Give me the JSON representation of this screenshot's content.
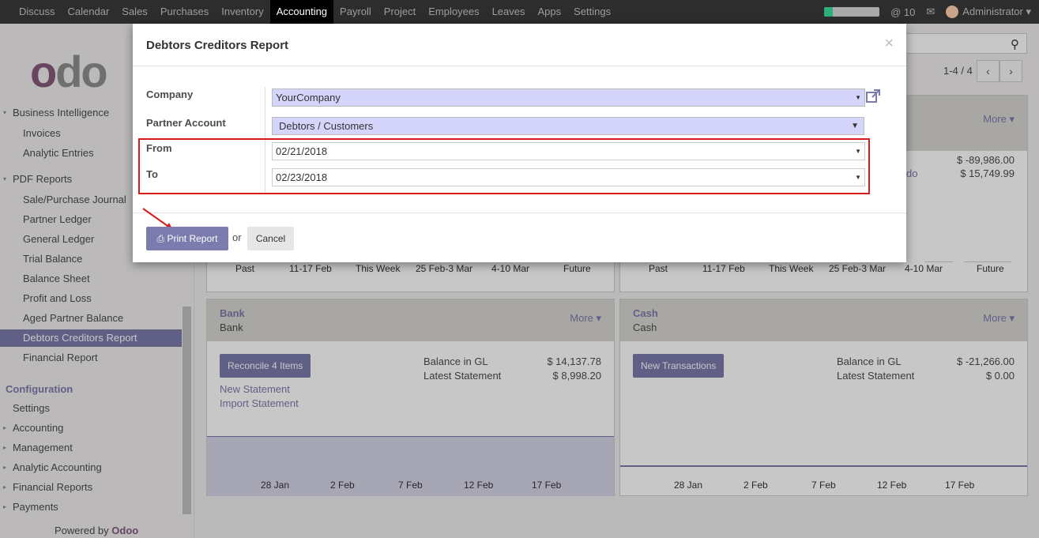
{
  "topbar": {
    "menu": [
      "Discuss",
      "Calendar",
      "Sales",
      "Purchases",
      "Inventory",
      "Accounting",
      "Payroll",
      "Project",
      "Employees",
      "Leaves",
      "Apps",
      "Settings"
    ],
    "active": "Accounting",
    "mentions": "@ 10",
    "user": "Administrator"
  },
  "sidebar": {
    "business_intelligence": "Business Intelligence",
    "invoices": "Invoices",
    "analytic_entries": "Analytic Entries",
    "pdf_reports": "PDF Reports",
    "reports": [
      "Sale/Purchase Journal",
      "Partner Ledger",
      "General Ledger",
      "Trial Balance",
      "Balance Sheet",
      "Profit and Loss",
      "Aged Partner Balance",
      "Debtors Creditors Report",
      "Financial Report"
    ],
    "configuration": "Configuration",
    "config_items": [
      "Settings",
      "Accounting",
      "Management",
      "Analytic Accounting",
      "Financial Reports",
      "Payments"
    ],
    "powered_by": "Powered by",
    "powered_brand": "Odoo"
  },
  "pager": {
    "text": "1-4 / 4"
  },
  "dashboard": {
    "top_left_axis": [
      "Past",
      "11-17 Feb",
      "This Week",
      "25 Feb-3 Mar",
      "4-10 Mar",
      "Future"
    ],
    "top_right_axis": [
      "Past",
      "11-17 Feb",
      "This Week",
      "25 Feb-3 Mar",
      "4-10 Mar",
      "Future"
    ],
    "top_right_more": "More",
    "top_right_val1": "$ -89,986.00",
    "top_right_val2": "$ 15,749.99",
    "top_right_link_frag": "do",
    "bank": {
      "title": "Bank",
      "subtitle": "Bank",
      "more": "More",
      "button": "Reconcile 4 Items",
      "link1": "New Statement",
      "link2": "Import Statement",
      "label1": "Balance in GL",
      "value1": "$ 14,137.78",
      "label2": "Latest Statement",
      "value2": "$ 8,998.20",
      "axis": [
        "28 Jan",
        "2 Feb",
        "7 Feb",
        "12 Feb",
        "17 Feb"
      ]
    },
    "cash": {
      "title": "Cash",
      "subtitle": "Cash",
      "more": "More",
      "button": "New Transactions",
      "label1": "Balance in GL",
      "value1": "$ -21,266.00",
      "label2": "Latest Statement",
      "value2": "$ 0.00",
      "axis": [
        "28 Jan",
        "2 Feb",
        "7 Feb",
        "12 Feb",
        "17 Feb"
      ]
    }
  },
  "modal": {
    "title": "Debtors Creditors Report",
    "close": "×",
    "company_label": "Company",
    "company_value": "YourCompany",
    "partner_label": "Partner Account",
    "partner_value": "Debtors / Customers",
    "from_label": "From",
    "from_value": "02/21/2018",
    "to_label": "To",
    "to_value": "02/23/2018",
    "print_button": "Print Report",
    "or_text": "or",
    "cancel_button": "Cancel"
  },
  "colors": {
    "accent": "#7c7bad",
    "brand": "#875a7b",
    "highlight": "#d81b1b"
  }
}
